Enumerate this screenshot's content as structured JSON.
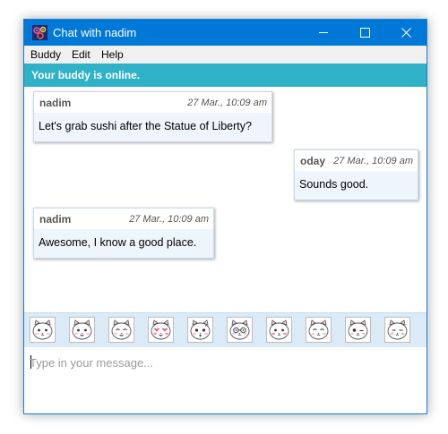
{
  "window": {
    "title": "Chat with nadim"
  },
  "menu": {
    "items": [
      {
        "label": "Buddy"
      },
      {
        "label": "Edit"
      },
      {
        "label": "Help"
      }
    ]
  },
  "status": {
    "text": "Your buddy is online."
  },
  "messages": [
    {
      "sender": "nadim",
      "time": "27 Mar., 10:09 am",
      "text": "Let's grab sushi after the Statue of Liberty?"
    },
    {
      "sender": "oday",
      "time": "27 Mar., 10:09 am",
      "text": "Sounds good."
    },
    {
      "sender": "nadim",
      "time": "27 Mar., 10:09 am",
      "text": "Awesome, I know a good place."
    }
  ],
  "emoticons": [
    "neutral-cat-icon",
    "smile-cat-icon",
    "happy-cat-icon",
    "heart-eyes-cat-icon",
    "surprised-cat-icon",
    "glasses-cat-icon",
    "blush-cat-icon",
    "content-cat-icon",
    "wink-cat-icon",
    "crying-cat-icon"
  ],
  "input": {
    "placeholder": "Type in your message..."
  },
  "colors": {
    "titlebar": "#0078d7",
    "status_bar": "#2fb1c7",
    "bubble_bg": "#eef5fd",
    "emoji_bar": "#daeaf7"
  }
}
